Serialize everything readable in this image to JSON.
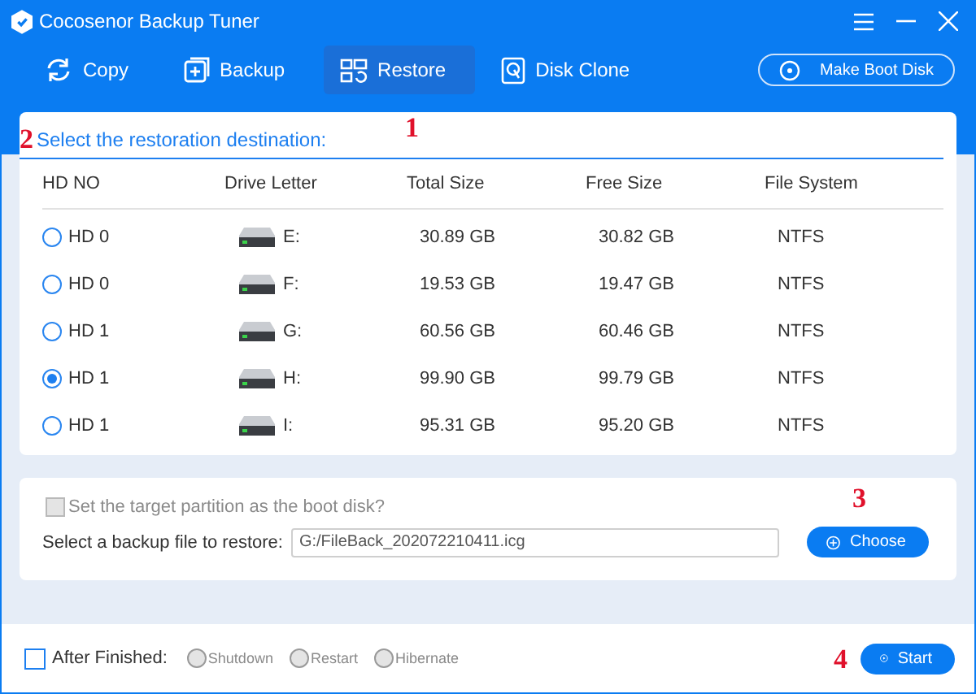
{
  "window": {
    "title": "Cocosenor Backup Tuner"
  },
  "tabs": [
    {
      "label": "Copy",
      "selected": false
    },
    {
      "label": "Backup",
      "selected": false
    },
    {
      "label": "Restore",
      "selected": true
    },
    {
      "label": "Disk Clone",
      "selected": false
    }
  ],
  "make_boot_disk_button": "Make Boot Disk",
  "annotations": [
    "1",
    "2",
    "3",
    "4"
  ],
  "destination": {
    "heading": "Select the restoration destination:",
    "columns": [
      "HD NO",
      "Drive Letter",
      "Total Size",
      "Free Size",
      "File System"
    ],
    "rows": [
      {
        "hd": "HD 0",
        "drive": "E:",
        "total": "30.89 GB",
        "free": "30.82 GB",
        "fs": "NTFS",
        "selected": false
      },
      {
        "hd": "HD 0",
        "drive": "F:",
        "total": "19.53 GB",
        "free": "19.47 GB",
        "fs": "NTFS",
        "selected": false
      },
      {
        "hd": "HD 1",
        "drive": "G:",
        "total": "60.56 GB",
        "free": "60.46 GB",
        "fs": "NTFS",
        "selected": false
      },
      {
        "hd": "HD 1",
        "drive": "H:",
        "total": "99.90 GB",
        "free": "99.79 GB",
        "fs": "NTFS",
        "selected": true
      },
      {
        "hd": "HD 1",
        "drive": "I:",
        "total": "95.31 GB",
        "free": "95.20 GB",
        "fs": "NTFS",
        "selected": false
      }
    ]
  },
  "boot_option": {
    "label": "Set the target partition as the boot disk?",
    "checked": false,
    "disabled": true
  },
  "backup_file": {
    "label": "Select a backup file to restore:",
    "value": "G:/FileBack_202072210411.icg",
    "button": "Choose"
  },
  "after_finished": {
    "label": "After Finished:",
    "checked": false,
    "options": [
      {
        "label": "Shutdown",
        "selected": false,
        "disabled": true
      },
      {
        "label": "Restart",
        "selected": false,
        "disabled": true
      },
      {
        "label": "Hibernate",
        "selected": false,
        "disabled": true
      }
    ]
  },
  "start_button": "Start"
}
